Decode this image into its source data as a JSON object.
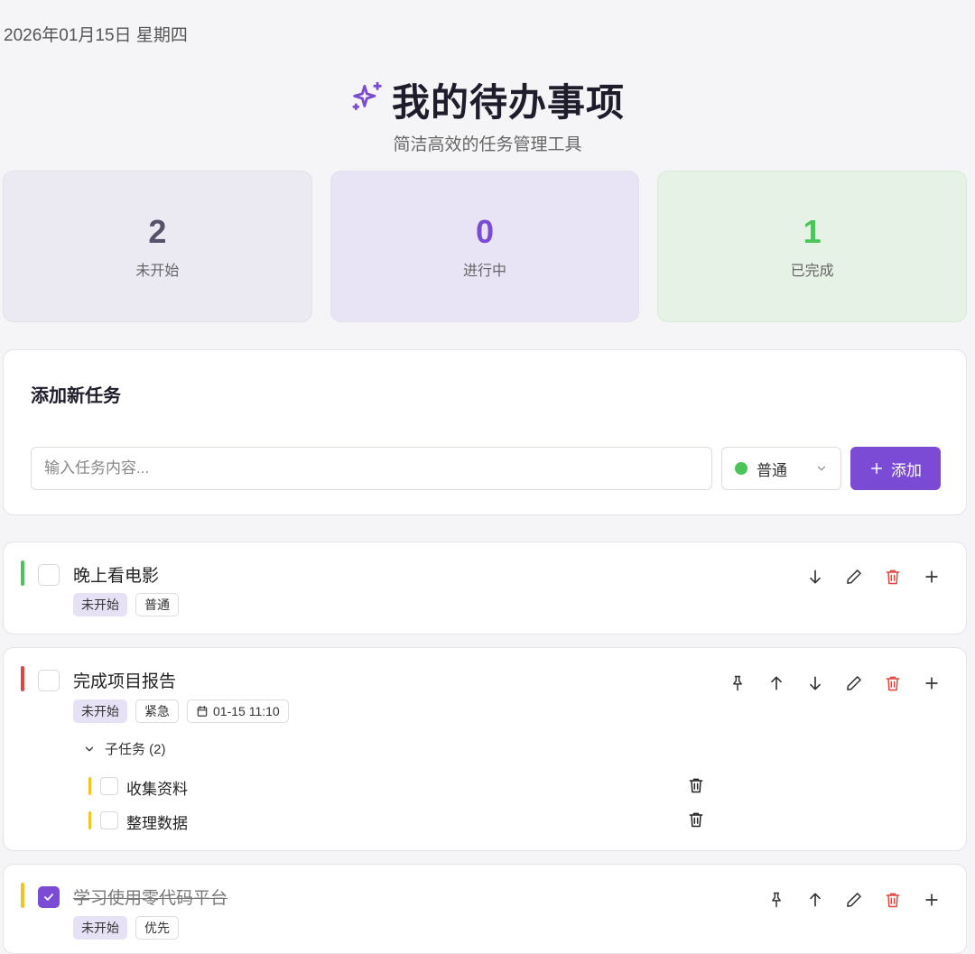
{
  "date": "2026年01月15日 星期四",
  "header": {
    "title": "我的待办事项",
    "subtitle": "简洁高效的任务管理工具",
    "icon": "sparkles-icon"
  },
  "stats": [
    {
      "count": "2",
      "label": "未开始"
    },
    {
      "count": "0",
      "label": "进行中"
    },
    {
      "count": "1",
      "label": "已完成"
    }
  ],
  "add_form": {
    "title": "添加新任务",
    "input_placeholder": "输入任务内容...",
    "input_value": "",
    "priority_selected": "普通",
    "add_label": "添加"
  },
  "tasks": [
    {
      "text": "晚上看电影",
      "status": "未开始",
      "priority": "普通",
      "priority_color": "#4cc45a",
      "checked": false
    },
    {
      "text": "完成项目报告",
      "status": "未开始",
      "priority": "紧急",
      "priority_color": "#e0463f",
      "due": "01-15 11:10",
      "checked": false,
      "subtasks_label": "子任务 (2)",
      "subtasks": [
        {
          "text": "收集资料"
        },
        {
          "text": "整理数据"
        }
      ]
    },
    {
      "text": "学习使用零代码平台",
      "status": "未开始",
      "priority": "优先",
      "priority_color": "#f2c322",
      "checked": true
    }
  ],
  "colors": {
    "accent": "#7b4bd6",
    "danger": "#e0463f",
    "success": "#4cc45a"
  }
}
